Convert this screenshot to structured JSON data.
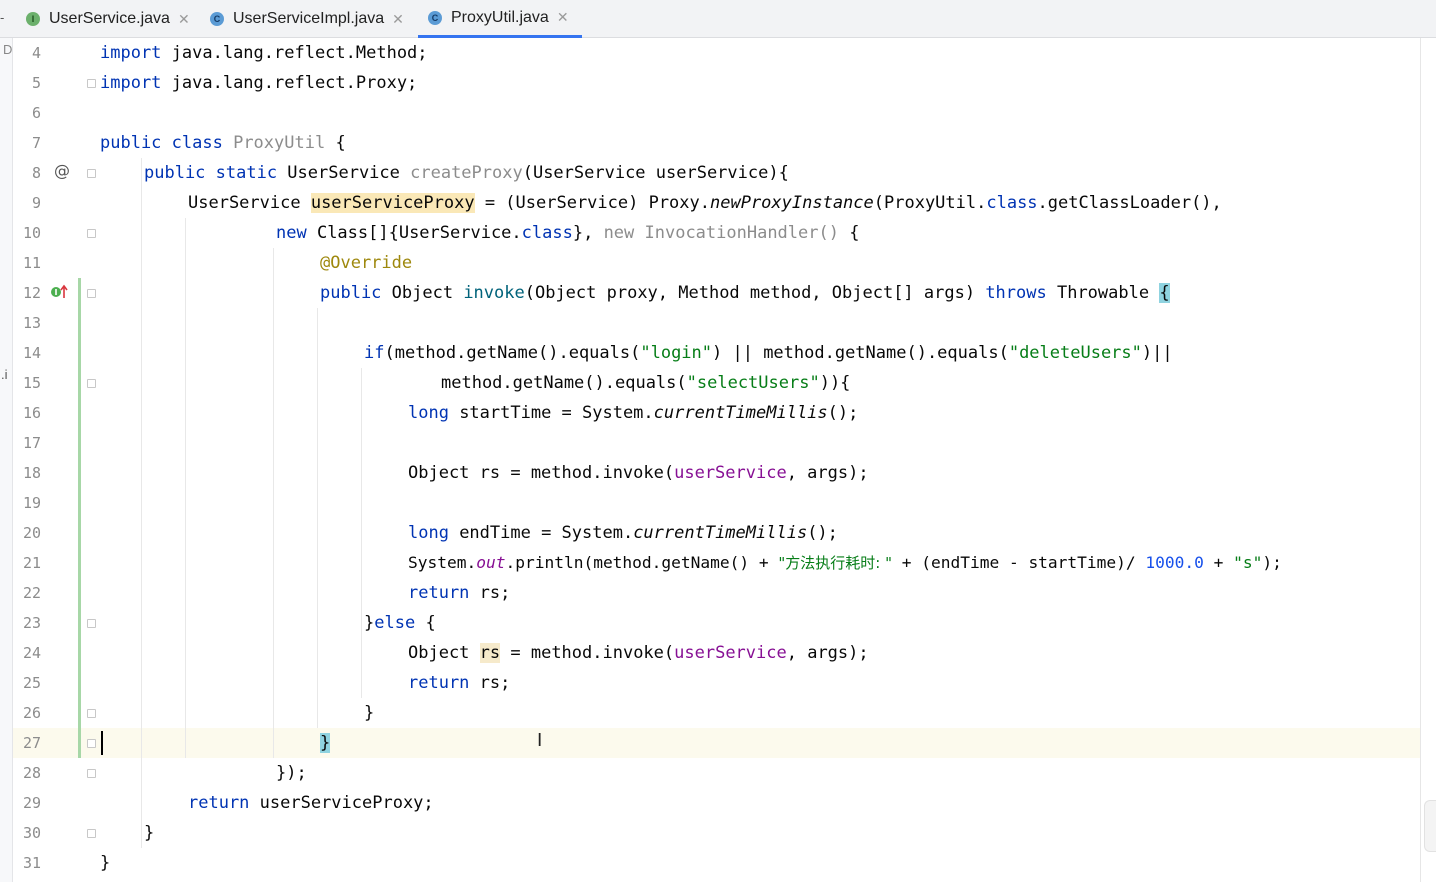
{
  "tabs": [
    {
      "label": "UserService.java",
      "icon": "interface-file-icon",
      "active": false
    },
    {
      "label": "UserServiceImpl.java",
      "icon": "class-file-icon",
      "active": false
    },
    {
      "label": "ProxyUtil.java",
      "icon": "class-file-icon",
      "active": true
    }
  ],
  "left_stub": {
    "top_text": "D",
    "mid_text": ".i",
    "tab_stub": "-"
  },
  "gutter": {
    "line_numbers": [
      "4",
      "5",
      "6",
      "7",
      "8",
      "9",
      "10",
      "11",
      "12",
      "13",
      "14",
      "15",
      "16",
      "17",
      "18",
      "19",
      "20",
      "21",
      "22",
      "23",
      "24",
      "25",
      "26",
      "27",
      "28",
      "29",
      "30",
      "31"
    ],
    "override_marker": "@"
  },
  "code": {
    "l4_a": "import",
    "l4_b": " java.lang.reflect.Method;",
    "l5_a": "import",
    "l5_b": " java.lang.reflect.Proxy;",
    "l7_a": "public class",
    "l7_b": " ",
    "l7_c": "ProxyUtil",
    "l7_d": " {",
    "l8_a": "public static",
    "l8_b": " UserService ",
    "l8_c": "createProxy",
    "l8_d": "(UserService userService){",
    "l9_a": "UserService ",
    "l9_b": "userServiceProxy",
    "l9_c": " = (UserService) Proxy.",
    "l9_d": "newProxyInstance",
    "l9_e": "(ProxyUtil.",
    "l9_f": "class",
    "l9_g": ".getClassLoader(),",
    "l10_a": "new",
    "l10_b": " Class[]{UserService.",
    "l10_c": "class",
    "l10_d": "}, ",
    "l10_e": "new InvocationHandler()",
    "l10_f": " {",
    "l11_a": "@Override",
    "l12_a": "public",
    "l12_b": " Object ",
    "l12_c": "invoke",
    "l12_d": "(Object proxy, Method method, Object[] args) ",
    "l12_e": "throws",
    "l12_f": " Throwable ",
    "l12_g": "{",
    "l14_a": "if",
    "l14_b": "(method.getName().equals(",
    "l14_c": "\"login\"",
    "l14_d": ") || method.getName().equals(",
    "l14_e": "\"deleteUsers\"",
    "l14_f": ")||",
    "l15_a": "method.getName().equals(",
    "l15_b": "\"selectUsers\"",
    "l15_c": ")){",
    "l16_a": "long",
    "l16_b": " startTime = System.",
    "l16_c": "currentTimeMillis",
    "l16_d": "();",
    "l18_a": "Object rs = method.invoke(",
    "l18_b": "userService",
    "l18_c": ", args);",
    "l20_a": "long",
    "l20_b": " endTime = System.",
    "l20_c": "currentTimeMillis",
    "l20_d": "();",
    "l21_a": "System.",
    "l21_b": "out",
    "l21_c": ".println(method.getName() + ",
    "l21_d": "\"方法执行耗时: \"",
    "l21_e": " + (endTime - startTime)/ ",
    "l21_f": "1000.0",
    "l21_g": " + ",
    "l21_h": "\"s\"",
    "l21_i": ");",
    "l22_a": "return",
    "l22_b": " rs;",
    "l23_a": "}",
    "l23_b": "else",
    "l23_c": " {",
    "l24_a": "Object ",
    "l24_b": "rs",
    "l24_c": " = method.invoke(",
    "l24_d": "userService",
    "l24_e": ", args);",
    "l25_a": "return",
    "l25_b": " rs;",
    "l26_a": "}",
    "l27_a": "}",
    "l28_a": "});",
    "l29_a": "return",
    "l29_b": " userServiceProxy;",
    "l30_a": "}",
    "l31_a": "}"
  }
}
